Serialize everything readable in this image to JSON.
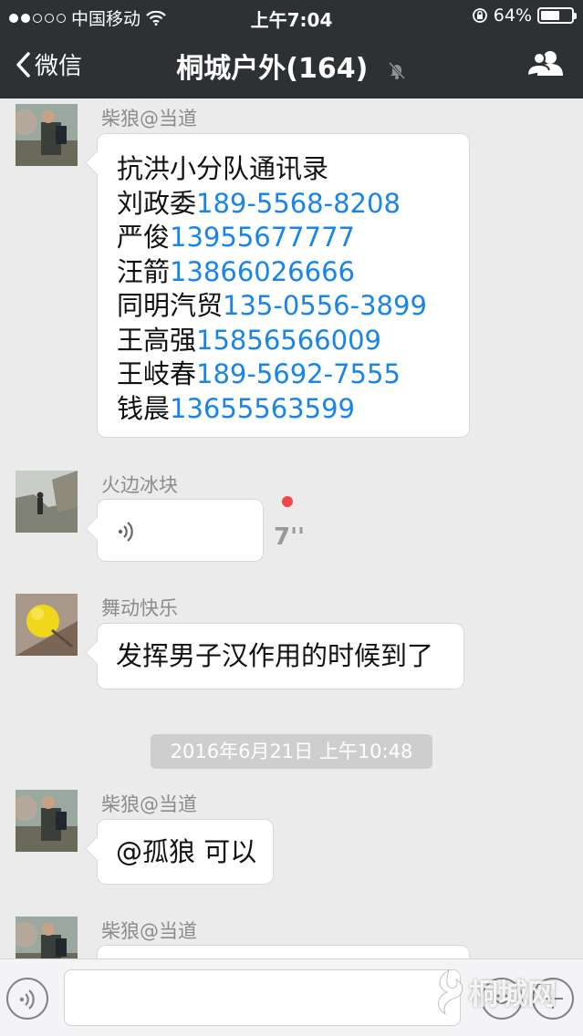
{
  "status_bar": {
    "carrier": "中国移动",
    "time": "上午7:04",
    "battery_percent": "64%",
    "battery_level": 0.64
  },
  "nav": {
    "back_label": "微信",
    "title": "桐城户外(164)"
  },
  "messages": [
    {
      "sender": "柴狼@当道",
      "lines": [
        {
          "name": "抗洪小分队通讯录",
          "phone": ""
        },
        {
          "name": "刘政委",
          "phone": "189-5568-8208"
        },
        {
          "name": "严俊",
          "phone": "13955677777"
        },
        {
          "name": "汪箭",
          "phone": "13866026666"
        },
        {
          "name": "同明汽贸",
          "phone": "135-0556-3899"
        },
        {
          "name": "王高强",
          "phone": "15856566009"
        },
        {
          "name": "王岐春",
          "phone": "189-5692-7555"
        },
        {
          "name": "钱晨",
          "phone": "13655563599"
        }
      ]
    },
    {
      "sender": "火边冰块",
      "voice_duration": "7''"
    },
    {
      "sender": "舞动快乐",
      "text": "发挥男子汉作用的时候到了"
    },
    {
      "timestamp": "2016年6月21日 上午10:48"
    },
    {
      "sender": "柴狼@当道",
      "text": "@孤狼 可以"
    },
    {
      "sender": "柴狼@当道"
    }
  ],
  "watermark": "桐城网",
  "colors": {
    "nav_bg": "#2e3134",
    "chat_bg": "#ebebeb",
    "phone_link": "#1a85e8",
    "unread_dot": "#f0474b"
  }
}
